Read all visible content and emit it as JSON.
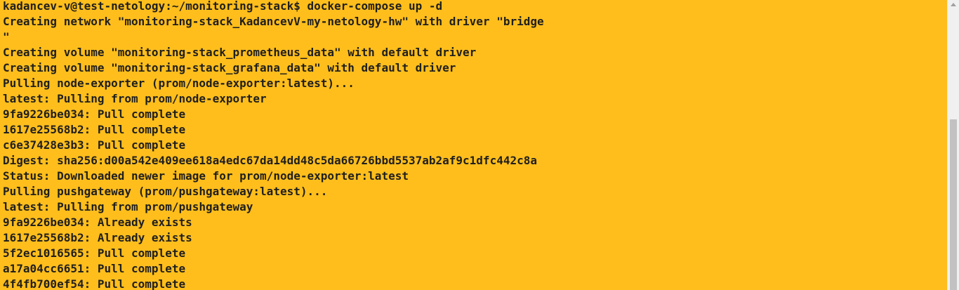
{
  "terminal": {
    "lines": [
      "kadancev-v@test-netology:~/monitoring-stack$ docker-compose up -d",
      "Creating network \"monitoring-stack_KadancevV-my-netology-hw\" with driver \"bridge",
      "\"",
      "Creating volume \"monitoring-stack_prometheus_data\" with default driver",
      "Creating volume \"monitoring-stack_grafana_data\" with default driver",
      "Pulling node-exporter (prom/node-exporter:latest)...",
      "latest: Pulling from prom/node-exporter",
      "9fa9226be034: Pull complete",
      "1617e25568b2: Pull complete",
      "c6e37428e3b3: Pull complete",
      "Digest: sha256:d00a542e409ee618a4edc67da14dd48c5da66726bbd5537ab2af9c1dfc442c8a",
      "Status: Downloaded newer image for prom/node-exporter:latest",
      "Pulling pushgateway (prom/pushgateway:latest)...",
      "latest: Pulling from prom/pushgateway",
      "9fa9226be034: Already exists",
      "1617e25568b2: Already exists",
      "5f2ec1016565: Pull complete",
      "a17a04cc6651: Pull complete",
      "4f4fb700ef54: Pull complete"
    ]
  },
  "colors": {
    "background": "#FFBE1C",
    "text": "#1f1f1f",
    "scrollbar_track": "#F0F0F0",
    "scrollbar_thumb": "#C2C2C2"
  }
}
